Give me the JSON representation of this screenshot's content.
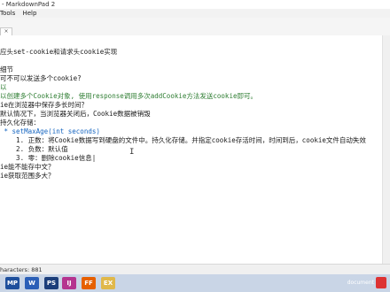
{
  "window": {
    "title": "- MarkdownPad 2"
  },
  "menu": {
    "items": [
      "Tools",
      "Help"
    ]
  },
  "tab": {
    "label": "×"
  },
  "editor": {
    "lines": [
      "应头set-cookie和请求头cookie实现",
      "",
      "细节",
      "可不可以发送多个cookie?",
      "以",
      "以创建多个Cookie对象, 使用response调用多次addCookie方法发送cookie即可。",
      "ie在浏览器中保存多长时间？",
      "默认情况下，当浏览器关闭后，Cookie数据被销毁",
      "持久化存储：",
      " * setMaxAge(int seconds)",
      "    1. 正数：将Cookie数据写到硬盘的文件中。持久化存储。并指定cookie存活时间，时间到后，cookie文件自动失效",
      "    2. 负数：默认值",
      "    3. 零：删除cookie信息|",
      "ie能不能存中文？",
      "ie获取范围多大？"
    ]
  },
  "status": {
    "characters": "haracters: 881"
  },
  "taskbar": {
    "icons": [
      "MP",
      "W",
      "PS",
      "IJ",
      "FF",
      "EX"
    ],
    "tray_text": "document"
  }
}
